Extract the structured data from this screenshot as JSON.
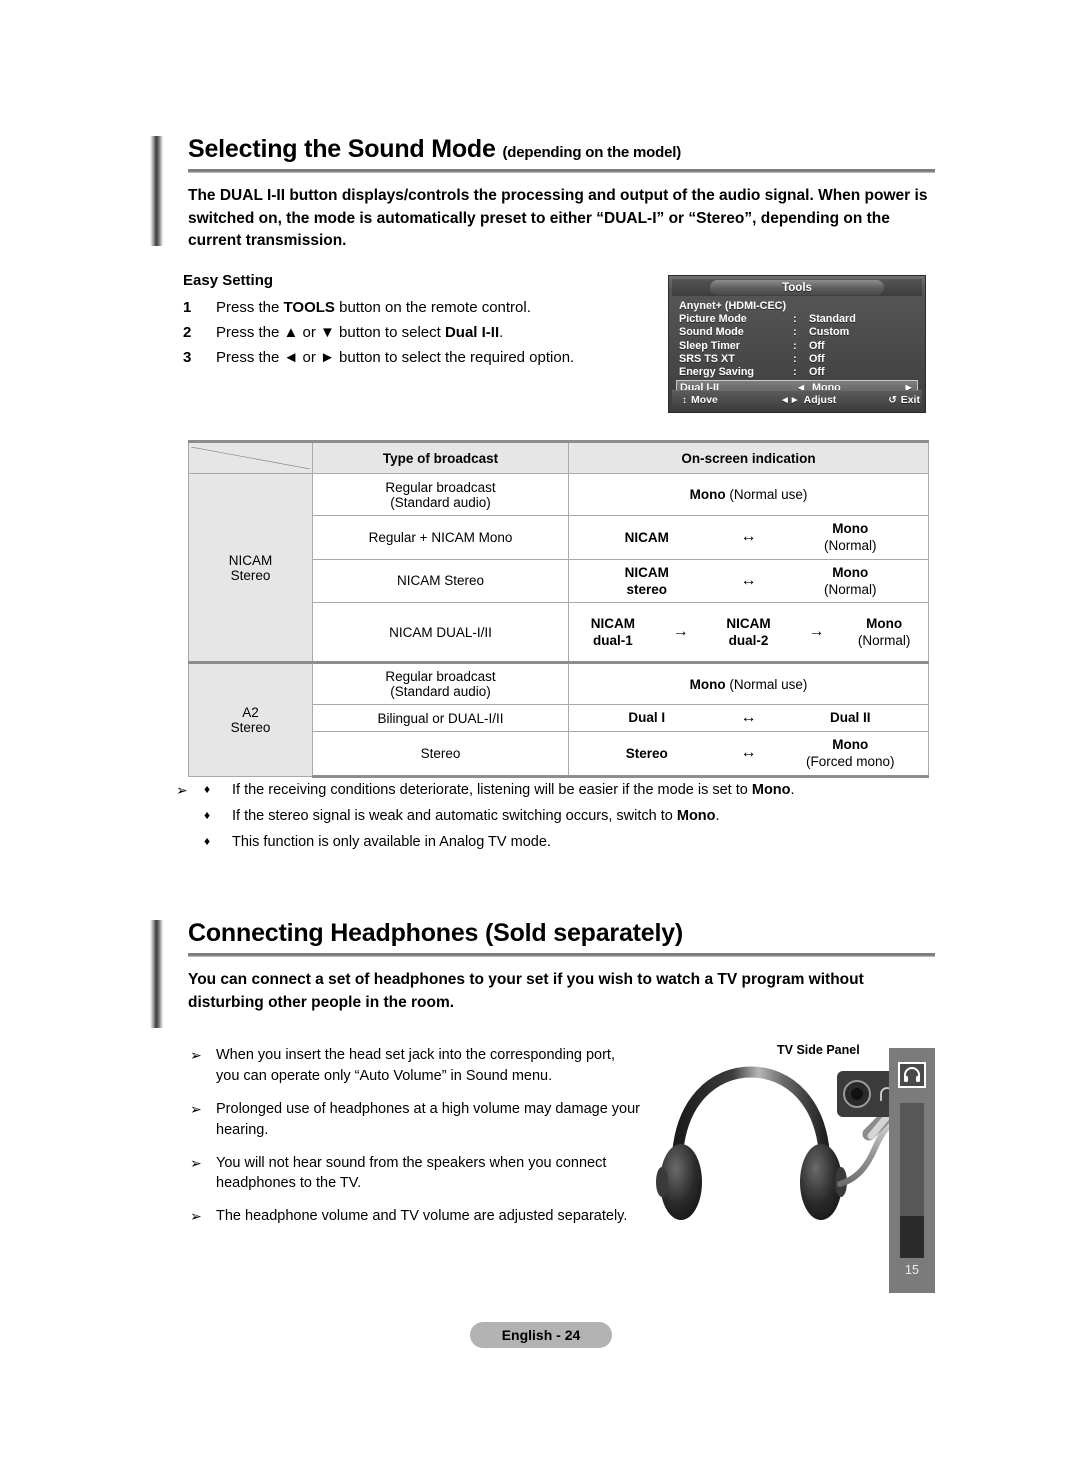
{
  "section1": {
    "title": "Selecting the Sound Mode",
    "title_sub": "(depending on the model)",
    "description": "The DUAL I-II button displays/controls the processing and output of the audio signal. When power is switched on, the mode is automatically preset to either “DUAL-I” or “Stereo”, depending on the current transmission."
  },
  "easy_setting": {
    "heading": "Easy Setting",
    "steps": [
      {
        "num": "1",
        "text_a": "Press the ",
        "bold": "TOOLS",
        "text_b": " button on the remote control."
      },
      {
        "num": "2",
        "text_a": "Press the ▲ or ▼ button to select ",
        "bold": "Dual I-II",
        "text_b": "."
      },
      {
        "num": "3",
        "text_a": "Press the ◄ or ► button to select the required option.",
        "bold": "",
        "text_b": ""
      }
    ]
  },
  "osd": {
    "title": "Tools",
    "rows": [
      {
        "label": "Anynet+ (HDMI-CEC)",
        "colon": "",
        "value": ""
      },
      {
        "label": "Picture Mode",
        "colon": ":",
        "value": "Standard"
      },
      {
        "label": "Sound Mode",
        "colon": ":",
        "value": "Custom"
      },
      {
        "label": "Sleep Timer",
        "colon": ":",
        "value": "Off"
      },
      {
        "label": "SRS TS XT",
        "colon": ":",
        "value": "Off"
      },
      {
        "label": "Energy Saving",
        "colon": ":",
        "value": "Off"
      }
    ],
    "selected": {
      "label": "Dual I-II",
      "left_arrow": "◄",
      "value": "Mono",
      "right_arrow": "►"
    },
    "footer": [
      {
        "glyph": "↕",
        "label": "Move"
      },
      {
        "glyph": "◄►",
        "label": "Adjust"
      },
      {
        "glyph": "↺",
        "label": "Exit"
      }
    ]
  },
  "table": {
    "headers": {
      "corner": "",
      "col2": "Type of broadcast",
      "col3": "On-screen indication"
    },
    "groups": [
      {
        "name": "NICAM\nStereo",
        "name_line1": "NICAM",
        "name_line2": "Stereo",
        "rows": [
          {
            "broadcast_line1": "Regular broadcast",
            "broadcast_line2": "(Standard audio)",
            "layout": "single",
            "single_bold": "Mono",
            "single_rest": " (Normal use)"
          },
          {
            "broadcast_line1": "Regular + NICAM Mono",
            "broadcast_line2": "",
            "layout": "two",
            "a_bold": "NICAM",
            "a_sub": "",
            "arrow1": "↔",
            "b_bold": "Mono",
            "b_sub": "(Normal)"
          },
          {
            "broadcast_line1": "NICAM Stereo",
            "broadcast_line2": "",
            "layout": "two",
            "a_bold": "NICAM",
            "a_sub": "stereo",
            "arrow1": "↔",
            "b_bold": "Mono",
            "b_sub": "(Normal)"
          },
          {
            "broadcast_line1": "NICAM DUAL-I/II",
            "broadcast_line2": "",
            "layout": "three",
            "a_bold": "NICAM",
            "a_sub": "dual-1",
            "arrow1": "→",
            "b_bold": "NICAM",
            "b_sub": "dual-2",
            "arrow2": "→",
            "c_bold": "Mono",
            "c_sub": "(Normal)"
          }
        ]
      },
      {
        "name_line1": "A2",
        "name_line2": "Stereo",
        "rows": [
          {
            "broadcast_line1": "Regular broadcast",
            "broadcast_line2": "(Standard audio)",
            "layout": "single",
            "single_bold": "Mono",
            "single_rest": " (Normal use)"
          },
          {
            "broadcast_line1": "Bilingual or DUAL-I/II",
            "broadcast_line2": "",
            "layout": "two",
            "a_bold": "Dual I",
            "a_sub": "",
            "arrow1": "↔",
            "b_bold": "Dual II",
            "b_sub": ""
          },
          {
            "broadcast_line1": "Stereo",
            "broadcast_line2": "",
            "layout": "two",
            "a_bold": "Stereo",
            "a_sub": "",
            "arrow1": "↔",
            "b_bold": "Mono",
            "b_sub": "(Forced mono)"
          }
        ]
      }
    ]
  },
  "notes_sound": {
    "lead_glyph": "➢",
    "bullet_glyph": "♦",
    "items": [
      {
        "text_a": "If the receiving conditions deteriorate, listening will be easier if the mode is set to ",
        "bold": "Mono",
        "text_b": "."
      },
      {
        "text_a": "If the stereo signal is weak and automatic switching occurs, switch to ",
        "bold": "Mono",
        "text_b": "."
      },
      {
        "text_a": "This function is only available in Analog TV mode.",
        "bold": "",
        "text_b": ""
      }
    ]
  },
  "section2": {
    "title": "Connecting Headphones (Sold separately)",
    "title_sub": "",
    "description": "You can connect a set of headphones to your set if you wish to watch a TV program without disturbing other people in the room."
  },
  "notes_headphones": {
    "lead_glyph": "➢",
    "items": [
      "When you insert the head set jack into the corresponding port, you can operate only “Auto Volume” in Sound menu.",
      "Prolonged use of headphones at a high volume may damage your hearing.",
      "You will not hear sound from the speakers when you connect headphones to the TV.",
      "The headphone volume and TV volume are adjusted separately."
    ]
  },
  "illustration": {
    "side_panel_label": "TV Side Panel",
    "volume_value": "15",
    "jack_icon": "headphone-icon",
    "panel_icon": "headphone-icon"
  },
  "footer": {
    "label": "English - 24"
  },
  "colors": {
    "page_background": "#ffffff",
    "table_shade": "#e6e6e6",
    "table_border": "#a9a9a9",
    "table_rule": "#8d8d8d",
    "osd_background": "#4a4a4a",
    "panel_gray": "#7b7b7b",
    "footer_pill": "#b3b3b3"
  }
}
